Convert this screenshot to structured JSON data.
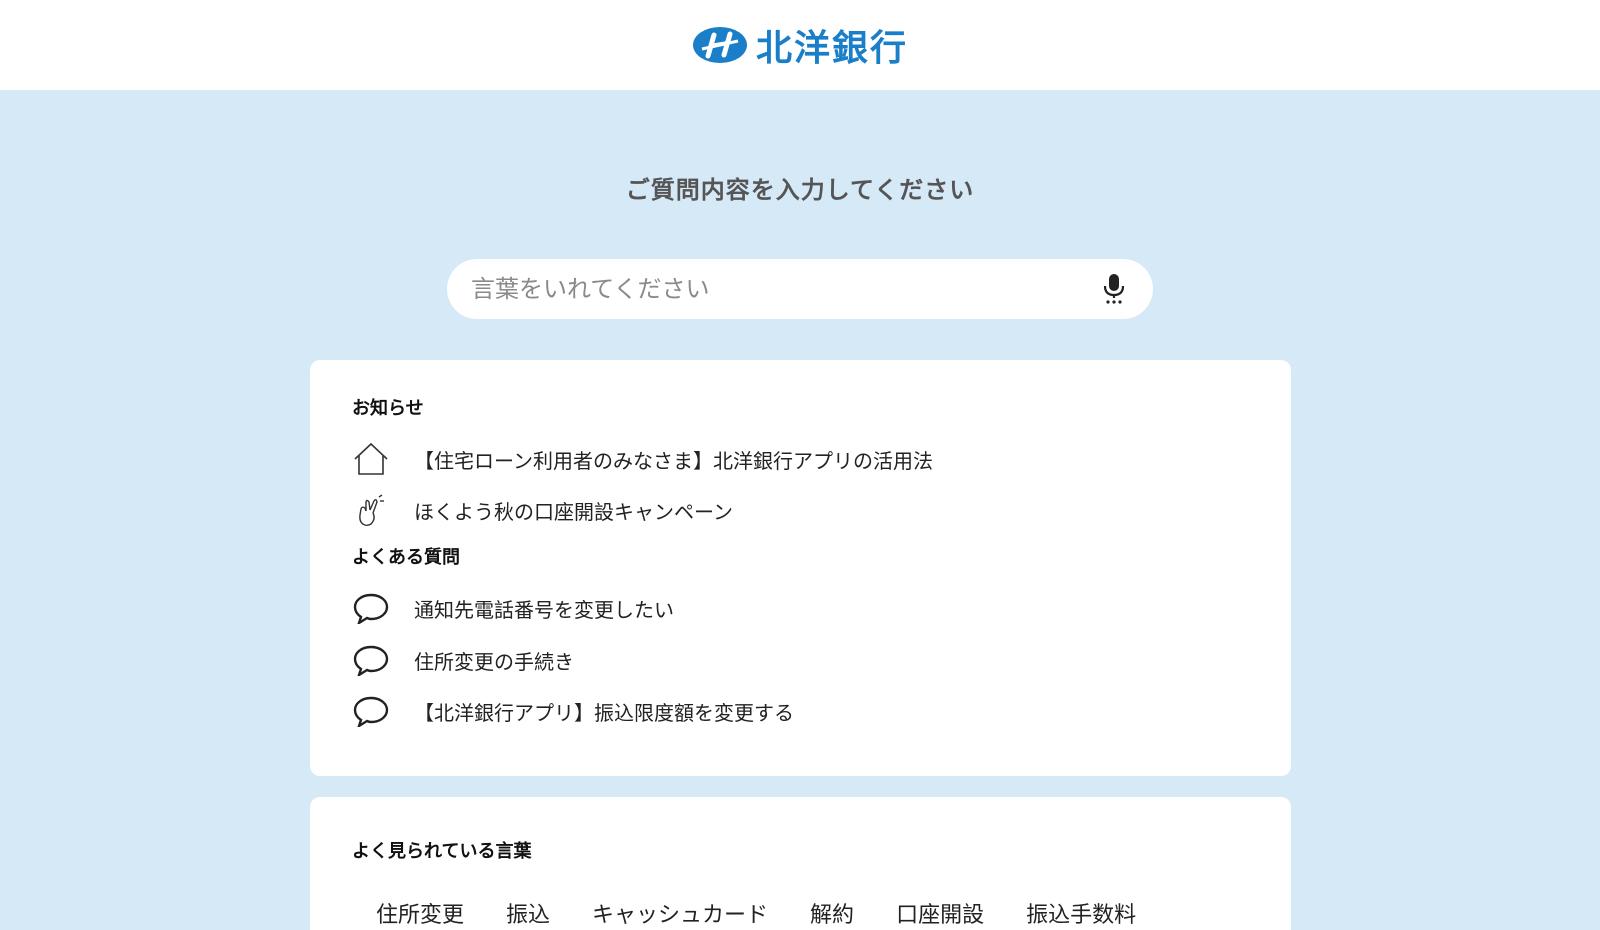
{
  "header": {
    "logo_text": "北洋銀行",
    "brand_color": "#1a7fc8"
  },
  "page_title": "ご質問内容を入力してください",
  "search": {
    "placeholder": "言葉をいれてください",
    "value": "",
    "mic_icon": "microphone-icon"
  },
  "notices": {
    "title": "お知らせ",
    "items": [
      {
        "icon": "house-icon",
        "label": "【住宅ローン利用者のみなさま】北洋銀行アプリの活用法"
      },
      {
        "icon": "crossed-fingers-icon",
        "label": "ほくよう秋の口座開設キャンペーン"
      }
    ]
  },
  "faq": {
    "title": "よくある質問",
    "items": [
      {
        "icon": "speech-bubble-icon",
        "label": "通知先電話番号を変更したい"
      },
      {
        "icon": "speech-bubble-icon",
        "label": "住所変更の手続き"
      },
      {
        "icon": "speech-bubble-icon",
        "label": "【北洋銀行アプリ】振込限度額を変更する"
      }
    ]
  },
  "popular": {
    "title": "よく見られている言葉",
    "tags": [
      "住所変更",
      "振込",
      "キャッシュカード",
      "解約",
      "口座開設",
      "振込手数料"
    ]
  },
  "colors": {
    "background": "#d5e9f7",
    "card": "#ffffff",
    "title_gray": "#555555"
  }
}
